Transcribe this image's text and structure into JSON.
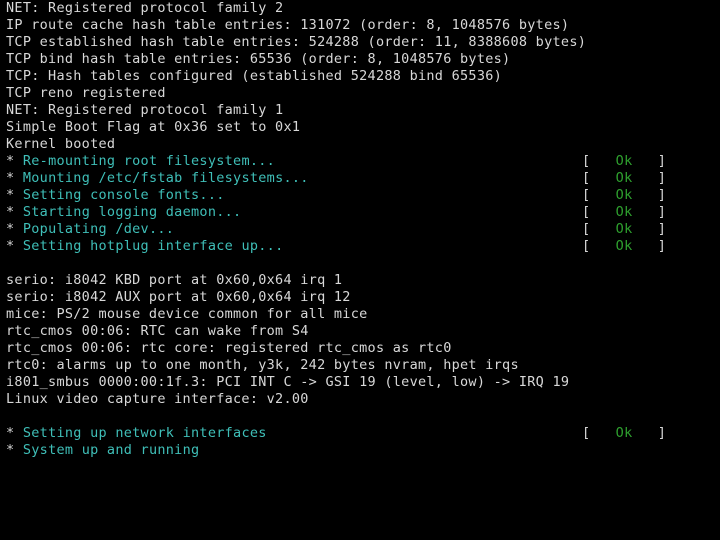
{
  "terminal": {
    "background_color": "#000000",
    "kernel_text_color": "#d8d8d8",
    "init_text_color": "#3fbfb8",
    "status_ok_color": "#2ea02e",
    "bracket_open": "[",
    "bracket_close": "]",
    "star_glyph": "*"
  },
  "lines": [
    {
      "type": "kernel",
      "text": "NET: Registered protocol family 2"
    },
    {
      "type": "kernel",
      "text": "IP route cache hash table entries: 131072 (order: 8, 1048576 bytes)"
    },
    {
      "type": "kernel",
      "text": "TCP established hash table entries: 524288 (order: 11, 8388608 bytes)"
    },
    {
      "type": "kernel",
      "text": "TCP bind hash table entries: 65536 (order: 8, 1048576 bytes)"
    },
    {
      "type": "kernel",
      "text": "TCP: Hash tables configured (established 524288 bind 65536)"
    },
    {
      "type": "kernel",
      "text": "TCP reno registered"
    },
    {
      "type": "kernel",
      "text": "NET: Registered protocol family 1"
    },
    {
      "type": "kernel",
      "text": "Simple Boot Flag at 0x36 set to 0x1"
    },
    {
      "type": "kernel",
      "text": "Kernel booted"
    },
    {
      "type": "init",
      "text": "Re-mounting root filesystem...",
      "status": "Ok"
    },
    {
      "type": "init",
      "text": "Mounting /etc/fstab filesystems...",
      "status": "Ok"
    },
    {
      "type": "init",
      "text": "Setting console fonts...",
      "status": "Ok"
    },
    {
      "type": "init",
      "text": "Starting logging daemon...",
      "status": "Ok"
    },
    {
      "type": "init",
      "text": "Populating /dev...",
      "status": "Ok"
    },
    {
      "type": "init",
      "text": "Setting hotplug interface up...",
      "status": "Ok"
    },
    {
      "type": "blank",
      "text": ""
    },
    {
      "type": "kernel",
      "text": "serio: i8042 KBD port at 0x60,0x64 irq 1"
    },
    {
      "type": "kernel",
      "text": "serio: i8042 AUX port at 0x60,0x64 irq 12"
    },
    {
      "type": "kernel",
      "text": "mice: PS/2 mouse device common for all mice"
    },
    {
      "type": "kernel",
      "text": "rtc_cmos 00:06: RTC can wake from S4"
    },
    {
      "type": "kernel",
      "text": "rtc_cmos 00:06: rtc core: registered rtc_cmos as rtc0"
    },
    {
      "type": "kernel",
      "text": "rtc0: alarms up to one month, y3k, 242 bytes nvram, hpet irqs"
    },
    {
      "type": "kernel",
      "text": "i801_smbus 0000:00:1f.3: PCI INT C -> GSI 19 (level, low) -> IRQ 19"
    },
    {
      "type": "kernel",
      "text": "Linux video capture interface: v2.00"
    },
    {
      "type": "blank",
      "text": ""
    },
    {
      "type": "init",
      "text": "Setting up network interfaces",
      "status": "Ok"
    },
    {
      "type": "init",
      "text": "System up and running"
    }
  ]
}
